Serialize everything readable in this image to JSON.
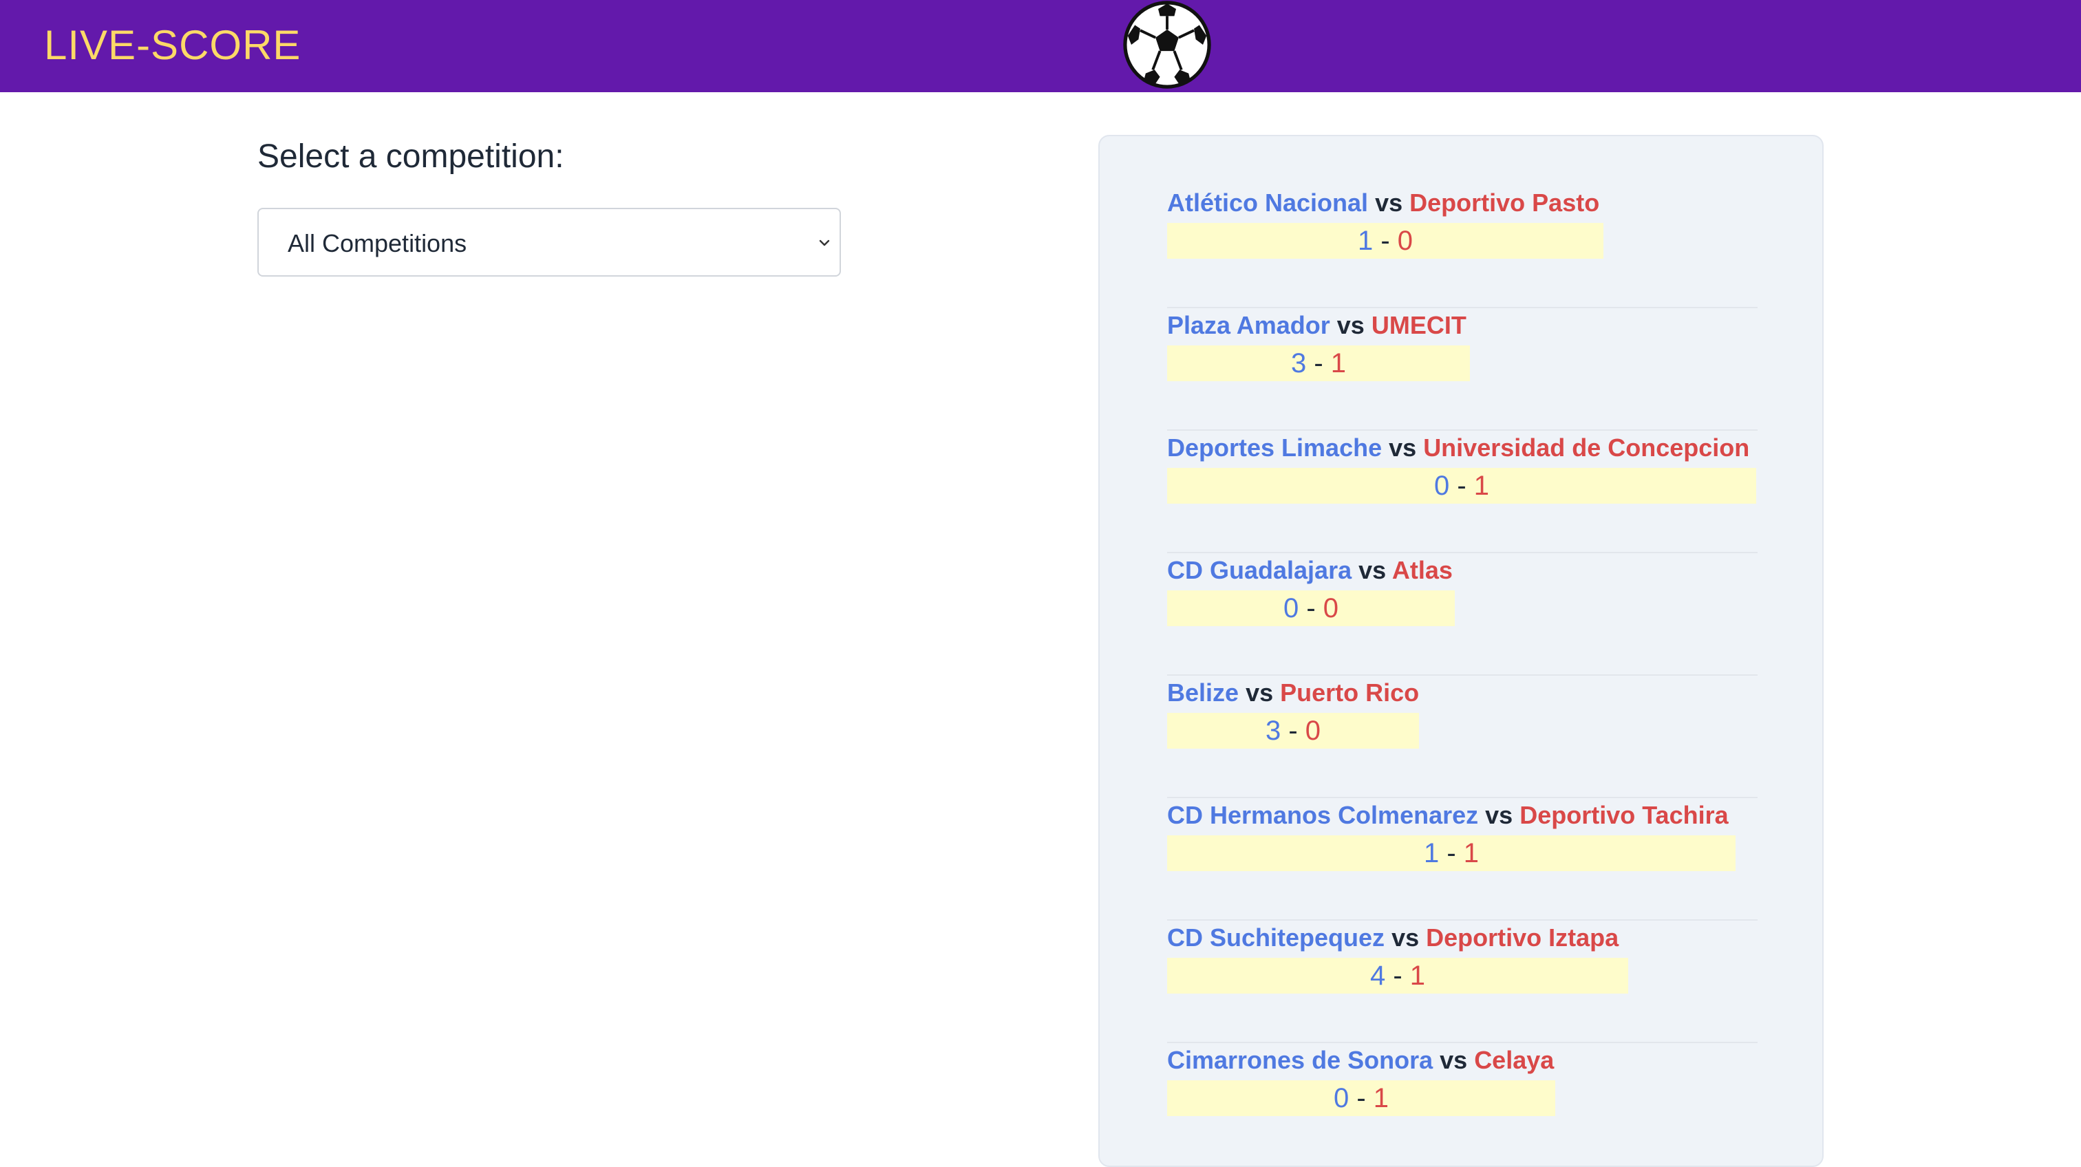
{
  "header": {
    "title": "LIVE-SCORE",
    "logo_icon": "soccer-ball-icon",
    "background_color": "#6319ab",
    "title_color": "#fcd967"
  },
  "filter": {
    "label": "Select a competition:",
    "selected": "All Competitions"
  },
  "matches": [
    {
      "home": "Atlético Nacional",
      "vs": "vs",
      "away": "Deportivo Pasto",
      "home_score": "1",
      "sep": "-",
      "away_score": "0"
    },
    {
      "home": "Plaza Amador",
      "vs": "vs",
      "away": "UMECIT",
      "home_score": "3",
      "sep": "-",
      "away_score": "1"
    },
    {
      "home": "Deportes Limache",
      "vs": "vs",
      "away": "Universidad de Concepcion",
      "home_score": "0",
      "sep": "-",
      "away_score": "1"
    },
    {
      "home": "CD Guadalajara",
      "vs": "vs",
      "away": "Atlas",
      "home_score": "0",
      "sep": "-",
      "away_score": "0"
    },
    {
      "home": "Belize",
      "vs": "vs",
      "away": "Puerto Rico",
      "home_score": "3",
      "sep": "-",
      "away_score": "0"
    },
    {
      "home": "CD Hermanos Colmenarez",
      "vs": "vs",
      "away": "Deportivo Tachira",
      "home_score": "1",
      "sep": "-",
      "away_score": "1"
    },
    {
      "home": "CD Suchitepequez",
      "vs": "vs",
      "away": "Deportivo Iztapa",
      "home_score": "4",
      "sep": "-",
      "away_score": "1"
    },
    {
      "home": "Cimarrones de Sonora",
      "vs": "vs",
      "away": "Celaya",
      "home_score": "0",
      "sep": "-",
      "away_score": "1"
    }
  ],
  "colors": {
    "home_team": "#4f79e1",
    "away_team": "#d94848",
    "score_highlight": "#fefccb"
  }
}
